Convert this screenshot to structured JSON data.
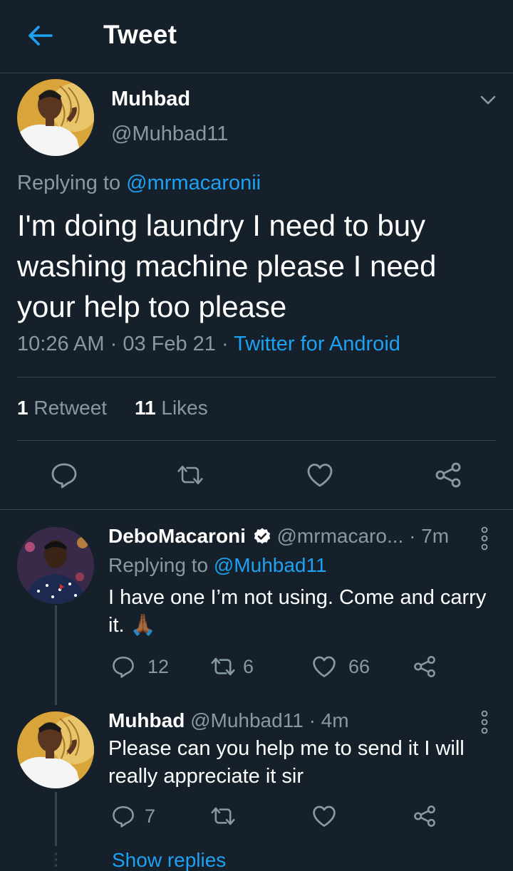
{
  "header": {
    "title": "Tweet"
  },
  "main_tweet": {
    "name": "Muhbad",
    "handle": "@Muhbad11",
    "replying_prefix": "Replying to",
    "replying_to": "@mrmacaronii",
    "text": "I'm doing laundry I need to buy washing machine please I need your help too please",
    "time": "10:26 AM",
    "date": "03 Feb 21",
    "source": "Twitter for Android",
    "retweet_count": "1",
    "retweet_label": "Retweet",
    "like_count": "11",
    "like_label": "Likes"
  },
  "replies": [
    {
      "name": "DeboMacaroni",
      "verified": true,
      "handle": "@mrmacaro...",
      "age": "7m",
      "replying_prefix": "Replying to",
      "replying_to": "@Muhbad11",
      "text": "I have one I’m not using. Come and carry it.",
      "emoji": "🙏🏾",
      "reply_count": "12",
      "retweet_count": "6",
      "like_count": "66"
    },
    {
      "name": "Muhbad",
      "handle": "@Muhbad11",
      "age": "4m",
      "text": "Please can you help me to send it I will really appreciate it sir",
      "reply_count": "7"
    }
  ],
  "show_replies": "Show replies",
  "colors": {
    "background": "#15202b",
    "accent": "#1da1f2",
    "muted": "#8899a6",
    "divider": "#38444d"
  }
}
